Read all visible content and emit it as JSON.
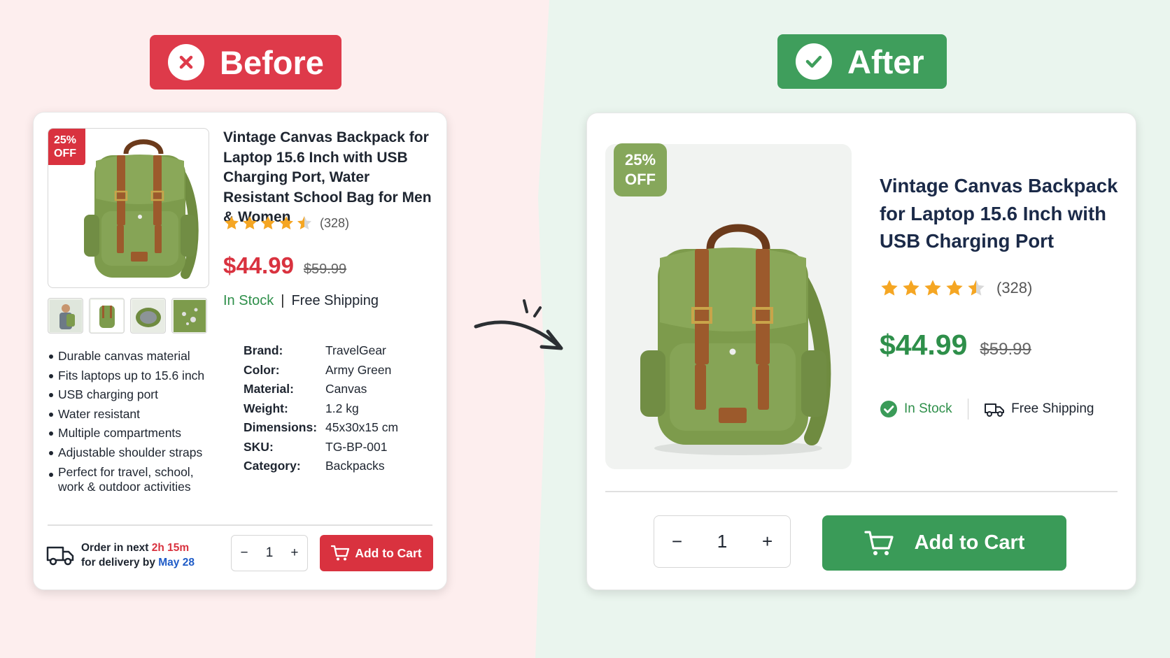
{
  "labels": {
    "before": "Before",
    "after": "After"
  },
  "before": {
    "badge_line1": "25%",
    "badge_line2": "OFF",
    "title": "Vintage Canvas Backpack for Laptop 15.6 Inch with USB Charging Port, Water Resistant School Bag for Men & Women",
    "rating": 4.5,
    "rating_count": "(328)",
    "price": "$44.99",
    "old_price": "$59.99",
    "stock": "In Stock",
    "separator": "|",
    "shipping": "Free Shipping",
    "features": [
      "Durable canvas material",
      "Fits laptops up to 15.6 inch",
      "USB charging port",
      "Water resistant",
      "Multiple compartments",
      "Adjustable shoulder straps",
      "Perfect for travel, school, work & outdoor activities"
    ],
    "specs": [
      {
        "key": "Brand:",
        "value": "TravelGear"
      },
      {
        "key": "Color:",
        "value": "Army Green"
      },
      {
        "key": "Material:",
        "value": "Canvas"
      },
      {
        "key": "Weight:",
        "value": "1.2 kg"
      },
      {
        "key": "Dimensions:",
        "value": "45x30x15 cm"
      },
      {
        "key": "SKU:",
        "value": "TG-BP-001"
      },
      {
        "key": "Category:",
        "value": "Backpacks"
      }
    ],
    "delivery": {
      "line1_prefix": "Order in next ",
      "countdown": "2h 15m",
      "line2_prefix": "for delivery by ",
      "date": "May 28"
    },
    "qty": "1",
    "minus": "−",
    "plus": "+",
    "cart_label": "Add to Cart"
  },
  "after": {
    "badge_line1": "25%",
    "badge_line2": "OFF",
    "title": "Vintage Canvas Backpack for Laptop 15.6 Inch with USB Charging Port",
    "rating": 4.5,
    "rating_count": "(328)",
    "price": "$44.99",
    "old_price": "$59.99",
    "stock": "In Stock",
    "shipping": "Free Shipping",
    "qty": "1",
    "minus": "−",
    "plus": "+",
    "cart_label": "Add to Cart"
  },
  "colors": {
    "before_accent": "#de3a4a",
    "after_accent": "#3f9e5c",
    "bg_left": "#fdeeee",
    "bg_right": "#eaf5ee",
    "star": "#f5a623",
    "bag_green": "#7d9b4c",
    "strap_brown": "#9c5a2c"
  },
  "icons": [
    "x-circle-icon",
    "check-circle-icon",
    "star-icon",
    "truck-icon",
    "cart-icon",
    "arrow-icon"
  ]
}
